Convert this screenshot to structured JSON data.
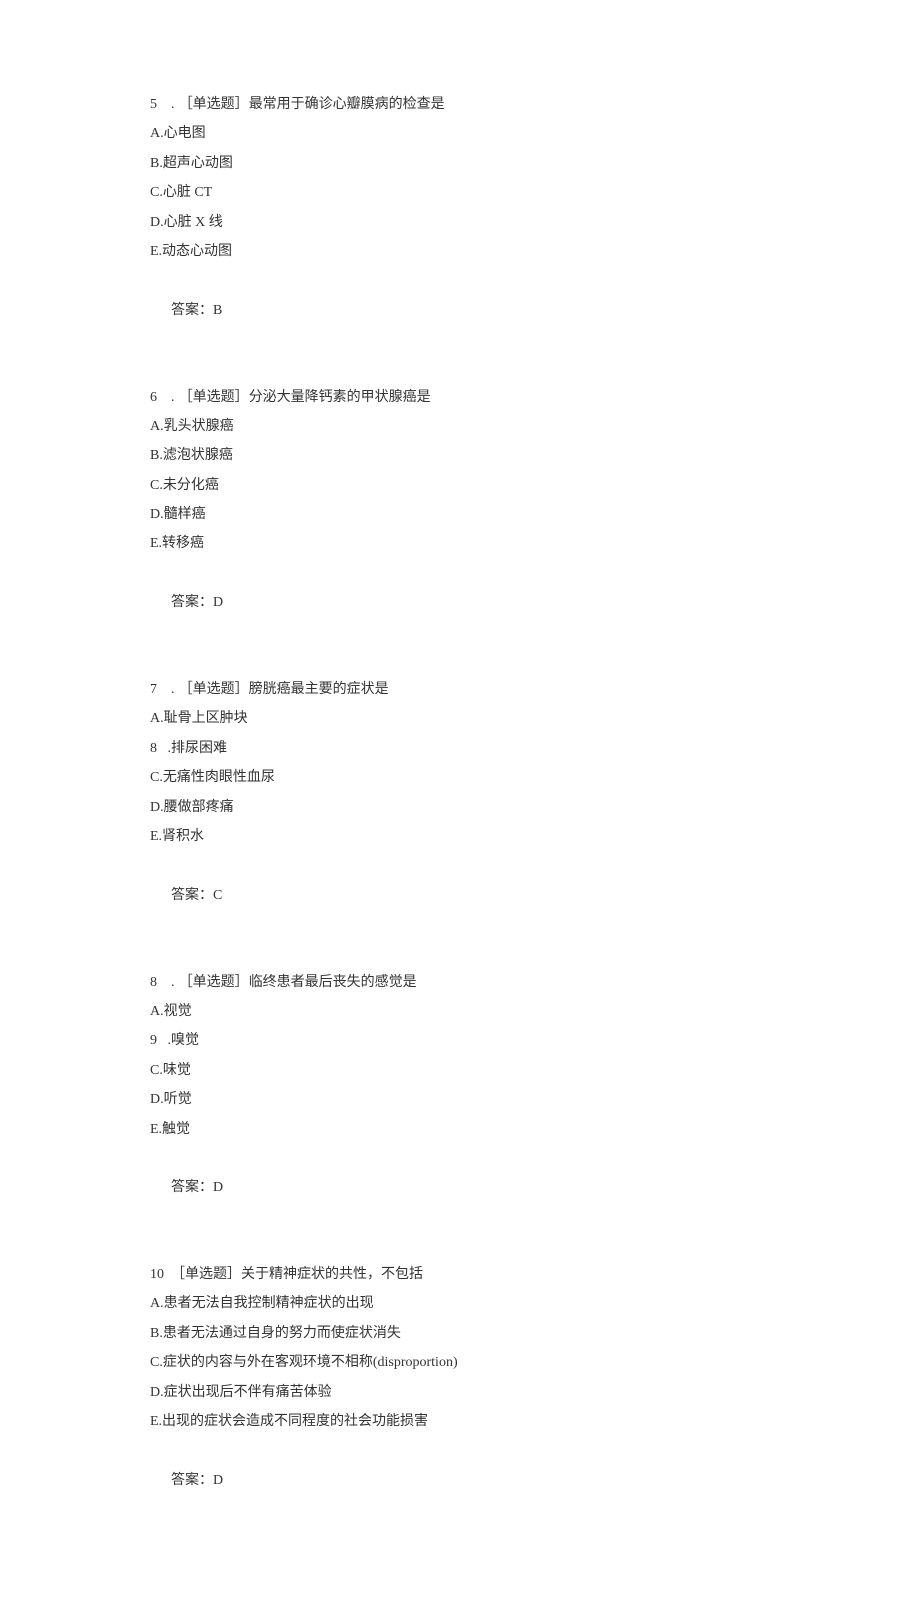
{
  "questions": [
    {
      "number": "5",
      "tag": "［单选题］",
      "stem": "最常用于确诊心瓣膜病的检查是",
      "options": [
        "A.心电图",
        "B.超声心动图",
        "C.心脏 CT",
        "D.心脏 X 线",
        "E.动态心动图"
      ],
      "answer_label": "答案：",
      "answer_value": "B"
    },
    {
      "number": "6",
      "tag": "［单选题］",
      "stem": "分泌大量降钙素的甲状腺癌是",
      "options": [
        "A.乳头状腺癌",
        "B.滤泡状腺癌",
        "C.未分化癌",
        "D.髓样癌",
        "E.转移癌"
      ],
      "answer_label": "答案：",
      "answer_value": "D"
    },
    {
      "number": "7",
      "tag": "［单选题］",
      "stem": "膀胱癌最主要的症状是",
      "options": [
        "A.耻骨上区肿块",
        "8   .排尿困难",
        "C.无痛性肉眼性血尿",
        "D.腰做部疼痛",
        "E.肾积水"
      ],
      "answer_label": "答案：",
      "answer_value": "C"
    },
    {
      "number": "8",
      "tag": "［单选题］",
      "stem": "临终患者最后丧失的感觉是",
      "options": [
        "A.视觉",
        "9   .嗅觉",
        "C.味觉",
        "D.听觉",
        "E.触觉"
      ],
      "answer_label": "答案：",
      "answer_value": "D"
    },
    {
      "number": "10",
      "tag": "［单选题］",
      "stem": "关于精神症状的共性，不包括",
      "options": [
        "A.患者无法自我控制精神症状的出现",
        "B.患者无法通过自身的努力而使症状消失",
        "C.症状的内容与外在客观环境不相称(disproportion)",
        "D.症状出现后不伴有痛苦体验",
        "E.出现的症状会造成不同程度的社会功能损害"
      ],
      "answer_label": "答案：",
      "answer_value": "D"
    }
  ]
}
